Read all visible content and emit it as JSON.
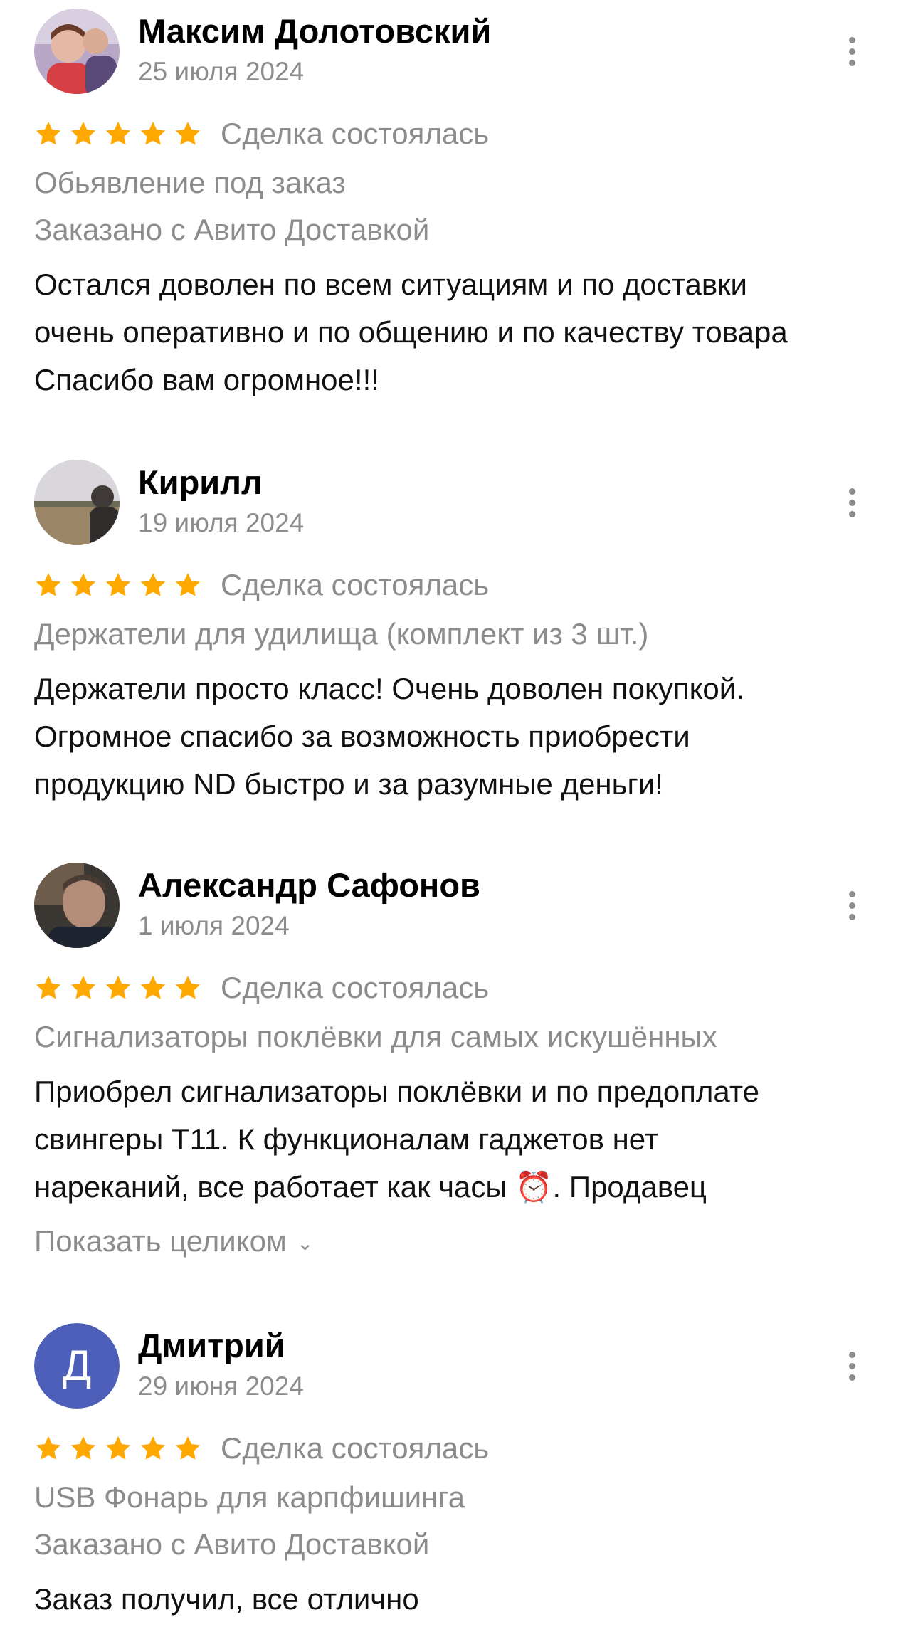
{
  "reviews": [
    {
      "name": "Максим Долотовский",
      "date": "25 июля 2024",
      "status": "Сделка состоялась",
      "rating": 5,
      "item": "Обьявление под заказ",
      "delivery": "Заказано с Авито Доставкой",
      "text": "Остался доволен по всем ситуациям и по доставки\nочень оперативно и по общению и по качеству товара\nСпасибо вам огромное!!!"
    },
    {
      "name": "Кирилл",
      "date": "19 июля 2024",
      "status": "Сделка состоялась",
      "rating": 5,
      "item": "Держатели для удилища (комплект из 3 шт.)",
      "text": "Держатели просто класс! Очень доволен покупкой.\nОгромное спасибо за возможность приобрести\nпродукцию ND быстро и за разумные деньги!"
    },
    {
      "name": "Александр Сафонов",
      "date": "1 июля 2024",
      "status": "Сделка состоялась",
      "rating": 5,
      "item": "Сигнализаторы поклёвки для самых искушённых",
      "text": "Приобрел сигнализаторы поклёвки и по предоплате\nсвингеры Т11. К функционалам гаджетов нет\nнареканий, все работает как часы ⏰. Продавец",
      "show_more": "Показать целиком"
    },
    {
      "name": "Дмитрий",
      "avatar_letter": "Д",
      "date": "29 июня 2024",
      "status": "Сделка состоялась",
      "rating": 5,
      "item": "USB Фонарь для карпфишинга",
      "delivery": "Заказано с Авито Доставкой",
      "text": "Заказ получил, все отлично"
    }
  ],
  "colors": {
    "star": "#ffa800",
    "secondary_text": "#8c8c8c",
    "avatar_letter_bg": "#4d5fb9"
  },
  "icons": {
    "star": "star-icon",
    "menu": "more-vertical-icon",
    "chevron": "chevron-down-icon"
  }
}
